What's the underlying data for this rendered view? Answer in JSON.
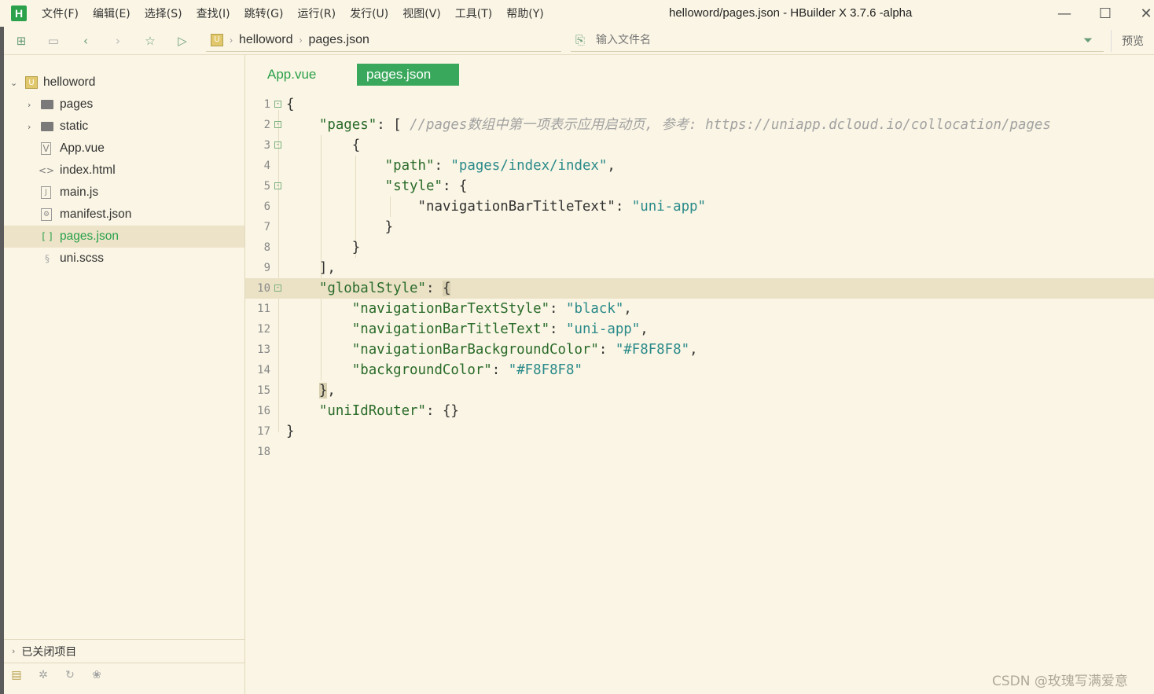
{
  "window": {
    "title": "helloword/pages.json - HBuilder X 3.7.6 -alpha",
    "logo": "H",
    "controls": {
      "minimize": "—",
      "maximize": "☐",
      "close": "✕"
    }
  },
  "menu": [
    "文件(F)",
    "编辑(E)",
    "选择(S)",
    "查找(I)",
    "跳转(G)",
    "运行(R)",
    "发行(U)",
    "视图(V)",
    "工具(T)",
    "帮助(Y)"
  ],
  "toolbar": {
    "breadcrumb": [
      "helloword",
      "pages.json"
    ],
    "file_search_placeholder": "输入文件名",
    "preview_label": "预览"
  },
  "sidebar": {
    "project": "helloword",
    "items": [
      {
        "label": "pages",
        "type": "folder",
        "icon": "folder-icon"
      },
      {
        "label": "static",
        "type": "folder",
        "icon": "folder-icon"
      },
      {
        "label": "App.vue",
        "type": "file",
        "icon": "vue-file-icon"
      },
      {
        "label": "index.html",
        "type": "file",
        "icon": "html-file-icon"
      },
      {
        "label": "main.js",
        "type": "file",
        "icon": "js-file-icon"
      },
      {
        "label": "manifest.json",
        "type": "file",
        "icon": "manifest-file-icon"
      },
      {
        "label": "pages.json",
        "type": "file",
        "icon": "json-file-icon",
        "selected": true
      },
      {
        "label": "uni.scss",
        "type": "file",
        "icon": "scss-file-icon"
      }
    ],
    "closed_projects_label": "已关闭项目"
  },
  "tabs": [
    {
      "label": "App.vue",
      "active": false
    },
    {
      "label": "pages.json",
      "active": true
    }
  ],
  "editor": {
    "current_line": 10,
    "lines": [
      "1",
      "2",
      "3",
      "4",
      "5",
      "6",
      "7",
      "8",
      "9",
      "10",
      "11",
      "12",
      "13",
      "14",
      "15",
      "16",
      "17",
      "18"
    ],
    "code": {
      "l1": "{",
      "l2_key": "\"pages\"",
      "l2_rest": ": [ ",
      "l2_comment": "//pages数组中第一项表示应用启动页, 参考: https://uniapp.dcloud.io/collocation/pages",
      "l3": "{",
      "l4_key": "\"path\"",
      "l4_val": "\"pages/index/index\"",
      "l5_key": "\"style\"",
      "l5_rest": ": {",
      "l6_key": "\"navigationBarTitleText\"",
      "l6_val": "\"uni-app\"",
      "l7": "}",
      "l8": "}",
      "l9": "],",
      "l10_key": "\"globalStyle\"",
      "l10_rest": ": ",
      "l10_brace": "{",
      "l11_key": "\"navigationBarTextStyle\"",
      "l11_val": "\"black\"",
      "l12_key": "\"navigationBarTitleText\"",
      "l12_val": "\"uni-app\"",
      "l13_key": "\"navigationBarBackgroundColor\"",
      "l13_val": "\"#F8F8F8\"",
      "l14_key": "\"backgroundColor\"",
      "l14_val": "\"#F8F8F8\"",
      "l15_brace": "}",
      "l15_rest": ",",
      "l16_key": "\"uniIdRouter\"",
      "l16_rest": ": {}",
      "l17": "}"
    }
  },
  "watermark": "CSDN @玫瑰写满爱意",
  "colors": {
    "accent": "#2aa14a",
    "background": "#faf5e4",
    "active_tab": "#3aa85c",
    "current_line": "#ebe2c6"
  }
}
